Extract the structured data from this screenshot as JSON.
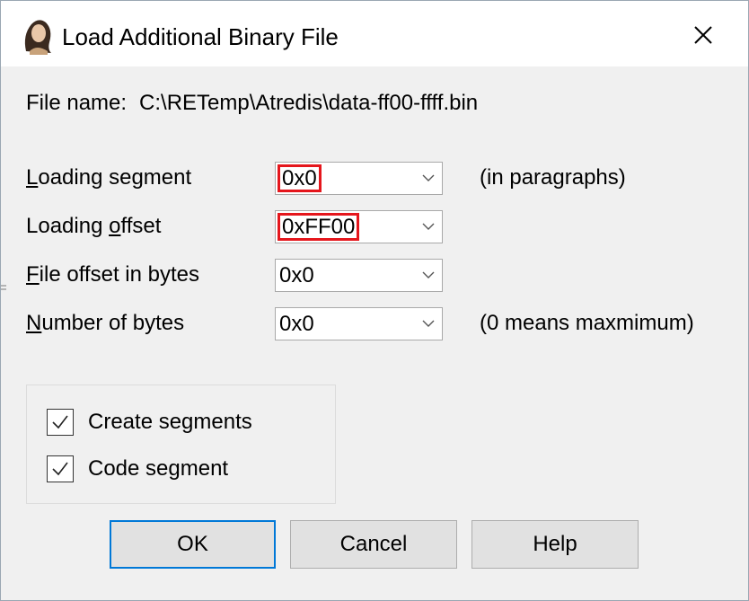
{
  "window": {
    "title": "Load Additional Binary File",
    "app_icon": "portrait-icon",
    "close_icon": "close-icon"
  },
  "file": {
    "label": "File name:",
    "value": "C:\\RETemp\\Atredis\\data-ff00-ffff.bin"
  },
  "fields": {
    "loading_segment": {
      "label": "Loading segment",
      "value": "0x0",
      "hint": "(in paragraphs)"
    },
    "loading_offset": {
      "label": "Loading offset",
      "value": "0xFF00"
    },
    "file_offset": {
      "label": "File offset in bytes",
      "value": "0x0"
    },
    "num_bytes": {
      "label": "Number of bytes",
      "value": "0x0",
      "hint": "(0 means maxmimum)"
    }
  },
  "options": {
    "create_segments": {
      "label": "Create segments",
      "checked": true
    },
    "code_segment": {
      "label": "Code segment",
      "checked": true
    }
  },
  "buttons": {
    "ok": "OK",
    "cancel": "Cancel",
    "help": "Help"
  },
  "colors": {
    "highlight": "#e5161c",
    "focus_border": "#0078d7",
    "dialog_bg": "#f0f0f0"
  }
}
